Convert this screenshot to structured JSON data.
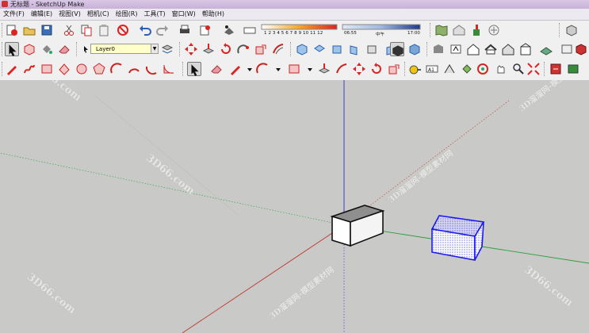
{
  "window": {
    "title": "无标题 - SketchUp Make"
  },
  "menu": {
    "items": [
      "文件(F)",
      "编辑(E)",
      "视图(V)",
      "相机(C)",
      "绘图(R)",
      "工具(T)",
      "窗口(W)",
      "帮助(H)"
    ]
  },
  "layers": {
    "current": "Layer0"
  },
  "shadows": {
    "months": "1 2 3 4 5 6 7 8 9 10 11 12",
    "time_start": "06:55",
    "time_mid": "中午",
    "time_end": "17:00"
  },
  "watermarks": [
    "3D66.com",
    "3D66.com",
    "3D66.com",
    "3D66.com",
    "3D溜溜网-模型素材网",
    "3D溜溜网-模型素材网",
    "3D溜溜网-模型素材网"
  ],
  "colors": {
    "axis_red": "#c0392b",
    "axis_green": "#2e9e3e",
    "axis_blue": "#2b2bd6",
    "selection_blue": "#1a1aee",
    "sky": "#c9c9c7"
  }
}
